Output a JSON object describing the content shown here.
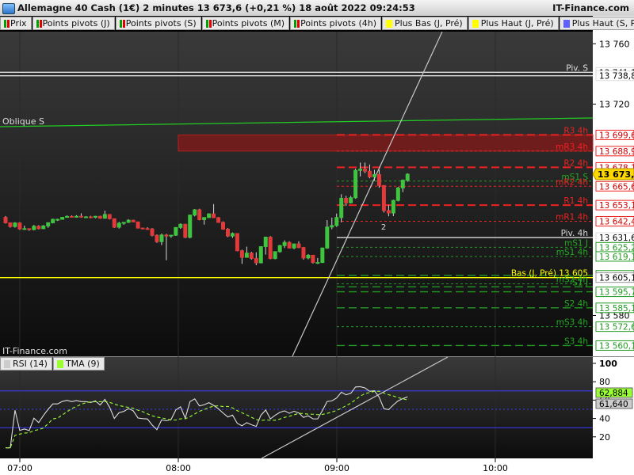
{
  "header": {
    "title": "Allemagne 40 Cash (1€) 2 minutes 13 673,6 (+0,21 %) 18 août 2022 09:24:53",
    "brand": "IT-Finance.com"
  },
  "legend": [
    {
      "label": "Prix",
      "colors": [
        "#00a000",
        "#e00000"
      ]
    },
    {
      "label": "Points pivots (J)",
      "colors": [
        "#00a000",
        "#e00000"
      ]
    },
    {
      "label": "Points pivots (S)",
      "colors": [
        "#00a000",
        "#e00000"
      ]
    },
    {
      "label": "Points pivots (M)",
      "colors": [
        "#00a000",
        "#e00000"
      ]
    },
    {
      "label": "Points pivots (4h)",
      "colors": [
        "#00a000",
        "#e00000"
      ]
    },
    {
      "label": "Plus Bas (J, Pré)",
      "colors": [
        "#ffff00"
      ]
    },
    {
      "label": "Plus Haut (J, Pré)",
      "colors": [
        "#ffff00"
      ]
    },
    {
      "label": "Plus Haut (S, Pré)",
      "colors": [
        "#6060ff"
      ]
    }
  ],
  "watermark": "IT-Finance.com",
  "rsi_legend": [
    {
      "label": "RSI (14)",
      "colors": [
        "#cccccc"
      ]
    },
    {
      "label": "TMA (9)",
      "colors": [
        "#99ff33"
      ]
    }
  ],
  "chart_data": {
    "type": "candlestick",
    "price_axis": {
      "range": [
        13553,
        13768
      ],
      "ticks": [
        "13 760",
        "13 720",
        "13 580"
      ]
    },
    "time_axis": {
      "ticks": [
        "07:00",
        "08:00",
        "09:00",
        "10:00"
      ]
    },
    "levels": [
      {
        "label": "Piv. S",
        "price_label": "13 741,1",
        "value": 13741.1,
        "color": "#dddddd",
        "style": "solid"
      },
      {
        "label": "",
        "price_label": "13 738,8",
        "value": 13738.8,
        "color": "#dddddd",
        "style": "solid"
      },
      {
        "label": "R3 4h",
        "price_label": "13 699,6",
        "value": 13699.6,
        "color": "#ee2222",
        "style": "dash"
      },
      {
        "label": "mR3 4h",
        "price_label": "13 688,9",
        "value": 13688.9,
        "color": "#ee2222",
        "style": "dot"
      },
      {
        "label": "R2 4h",
        "price_label": "13 678,1",
        "value": 13678.1,
        "color": "#ee2222",
        "style": "dash"
      },
      {
        "label": "mS1 S",
        "price_label": "",
        "value": 13669.0,
        "color": "#229922",
        "style": "dot"
      },
      {
        "label": "mR2 4h",
        "price_label": "13 665,6",
        "value": 13665.6,
        "color": "#ee2222",
        "style": "dot"
      },
      {
        "label": "R1 4h",
        "price_label": "13 653,1",
        "value": 13653.1,
        "color": "#ee2222",
        "style": "dash"
      },
      {
        "label": "mR1 4h",
        "price_label": "13 642,4",
        "value": 13642.4,
        "color": "#ee2222",
        "style": "dot"
      },
      {
        "label": "Piv. 4h",
        "price_label": "13 631,6",
        "value": 13631.6,
        "color": "#dddddd",
        "style": "solid"
      },
      {
        "label": "mS1 J",
        "price_label": "13 625,2",
        "value": 13625.2,
        "color": "#229922",
        "style": "dot"
      },
      {
        "label": "mS1 4h",
        "price_label": "13 619,1",
        "value": 13619.1,
        "color": "#229922",
        "style": "dot"
      },
      {
        "label": "",
        "price_label": "13 606,6",
        "value": 13606.6,
        "color": "#229922",
        "style": "dash"
      },
      {
        "label": "Bas (J, Pré) 13 605",
        "price_label": "13 605,1",
        "value": 13605.1,
        "color": "#ffff00",
        "style": "solid"
      },
      {
        "label": "mS2 4h",
        "price_label": "",
        "value": 13601.0,
        "color": "#229922",
        "style": "dot"
      },
      {
        "label": "S1 J",
        "price_label": "",
        "value": 13599.0,
        "color": "#229922",
        "style": "dash"
      },
      {
        "label": "",
        "price_label": "13 595,7",
        "value": 13595.7,
        "color": "#229922",
        "style": "dash"
      },
      {
        "label": "S2 4h",
        "price_label": "13 585,1",
        "value": 13585.1,
        "color": "#229922",
        "style": "dash"
      },
      {
        "label": "mS3 4h",
        "price_label": "13 572,6",
        "value": 13572.6,
        "color": "#229922",
        "style": "dot"
      },
      {
        "label": "S3 4h",
        "price_label": "13 560,1",
        "value": 13560.1,
        "color": "#229922",
        "style": "dash"
      }
    ],
    "last_price": {
      "value": 13673.6,
      "label": "13 673,6"
    },
    "zone": {
      "from": 13688.9,
      "to": 13699.6,
      "color": "#7a1a1a"
    },
    "oblique": {
      "label": "Oblique S",
      "color": "#22cc22"
    },
    "annotation": "2",
    "candles": [
      [
        13645.0,
        13645.9,
        13640.9,
        13641.4
      ],
      [
        13641.4,
        13641.5,
        13638.2,
        13638.9
      ],
      [
        13638.9,
        13641.8,
        13638.2,
        13641.3
      ],
      [
        13641.3,
        13641.8,
        13636.7,
        13637.3
      ],
      [
        13637.3,
        13639.5,
        13636.9,
        13637.5
      ],
      [
        13637.5,
        13637.5,
        13636.1,
        13636.9
      ],
      [
        13636.9,
        13640.0,
        13636.4,
        13639.1
      ],
      [
        13639.1,
        13639.8,
        13637.0,
        13637.5
      ],
      [
        13637.5,
        13639.9,
        13637.2,
        13639.3
      ],
      [
        13639.3,
        13641.8,
        13638.1,
        13641.4
      ],
      [
        13641.4,
        13644.1,
        13641.0,
        13643.7
      ],
      [
        13643.7,
        13644.1,
        13642.6,
        13643.7
      ],
      [
        13643.7,
        13645.3,
        13643.5,
        13645.0
      ],
      [
        13645.0,
        13646.3,
        13644.8,
        13645.6
      ],
      [
        13645.6,
        13646.3,
        13645.0,
        13645.1
      ],
      [
        13645.1,
        13646.4,
        13644.8,
        13645.7
      ],
      [
        13645.7,
        13647.7,
        13644.7,
        13645.3
      ],
      [
        13645.3,
        13645.8,
        13645.1,
        13645.3
      ],
      [
        13645.3,
        13646.0,
        13644.4,
        13645.0
      ],
      [
        13645.0,
        13646.0,
        13644.4,
        13645.7
      ],
      [
        13645.7,
        13646.1,
        13644.1,
        13644.4
      ],
      [
        13644.4,
        13649.4,
        13644.2,
        13646.9
      ],
      [
        13646.9,
        13647.1,
        13643.6,
        13644.1
      ],
      [
        13644.1,
        13644.2,
        13638.0,
        13638.5
      ],
      [
        13638.5,
        13642.0,
        13637.6,
        13641.1
      ],
      [
        13641.1,
        13641.8,
        13640.1,
        13641.7
      ],
      [
        13641.7,
        13643.8,
        13641.3,
        13643.1
      ],
      [
        13643.1,
        13643.3,
        13641.9,
        13642.0
      ],
      [
        13642.0,
        13642.0,
        13637.6,
        13637.9
      ],
      [
        13637.9,
        13638.2,
        13637.0,
        13637.5
      ],
      [
        13637.5,
        13638.5,
        13636.9,
        13637.3
      ],
      [
        13637.3,
        13637.9,
        13632.4,
        13633.1
      ],
      [
        13633.1,
        13633.7,
        13628.1,
        13628.9
      ],
      [
        13628.9,
        13634.3,
        13626.6,
        13633.3
      ],
      [
        13633.3,
        13634.1,
        13616.6,
        13632.6
      ],
      [
        13632.6,
        13633.3,
        13631.5,
        13633.2
      ],
      [
        13633.2,
        13638.3,
        13632.7,
        13638.3
      ],
      [
        13638.3,
        13641.0,
        13637.4,
        13640.4
      ],
      [
        13640.4,
        13640.7,
        13631.2,
        13631.8
      ],
      [
        13631.8,
        13646.8,
        13631.1,
        13646.5
      ],
      [
        13646.5,
        13650.5,
        13645.7,
        13650.0
      ],
      [
        13650.0,
        13650.7,
        13643.0,
        13643.5
      ],
      [
        13643.5,
        13645.0,
        13640.2,
        13644.9
      ],
      [
        13644.9,
        13647.6,
        13644.6,
        13647.3
      ],
      [
        13647.3,
        13653.8,
        13644.6,
        13644.8
      ],
      [
        13644.8,
        13645.2,
        13641.4,
        13641.7
      ],
      [
        13641.7,
        13642.3,
        13636.8,
        13637.2
      ],
      [
        13637.2,
        13637.9,
        13631.9,
        13632.6
      ],
      [
        13632.6,
        13635.0,
        13631.4,
        13634.3
      ],
      [
        13634.3,
        13634.4,
        13622.5,
        13622.9
      ],
      [
        13622.9,
        13623.6,
        13614.2,
        13618.5
      ],
      [
        13618.5,
        13625.6,
        13618.4,
        13621.3
      ],
      [
        13621.3,
        13622.2,
        13617.0,
        13617.8
      ],
      [
        13617.8,
        13621.9,
        13613.3,
        13614.9
      ],
      [
        13614.9,
        13625.9,
        13614.5,
        13625.6
      ],
      [
        13625.6,
        13632.2,
        13620.3,
        13631.9
      ],
      [
        13631.9,
        13632.6,
        13617.2,
        13617.7
      ],
      [
        13617.7,
        13622.4,
        13617.2,
        13622.3
      ],
      [
        13622.3,
        13626.8,
        13621.6,
        13626.3
      ],
      [
        13626.3,
        13629.8,
        13624.7,
        13628.4
      ],
      [
        13628.4,
        13629.2,
        13624.4,
        13624.7
      ],
      [
        13624.7,
        13627.5,
        13623.9,
        13627.4
      ],
      [
        13627.4,
        13629.2,
        13624.6,
        13625.0
      ],
      [
        13625.0,
        13625.4,
        13617.0,
        13618.1
      ],
      [
        13618.1,
        13620.7,
        13617.2,
        13619.9
      ],
      [
        13619.9,
        13620.0,
        13614.4,
        13615.1
      ],
      [
        13615.1,
        13618.1,
        13614.1,
        13615.1
      ],
      [
        13615.1,
        13625.0,
        13614.8,
        13624.7
      ],
      [
        13624.7,
        13643.2,
        13624.1,
        13638.6
      ],
      [
        13638.6,
        13644.8,
        13637.1,
        13639.6
      ],
      [
        13639.6,
        13647.5,
        13638.7,
        13644.9
      ],
      [
        13644.9,
        13660.3,
        13641.7,
        13657.6
      ],
      [
        13657.6,
        13659.2,
        13652.6,
        13654.6
      ],
      [
        13654.6,
        13659.2,
        13654.2,
        13658.0
      ],
      [
        13658.0,
        13677.2,
        13657.3,
        13676.1
      ],
      [
        13676.1,
        13681.3,
        13672.1,
        13676.9
      ],
      [
        13676.9,
        13681.3,
        13674.3,
        13675.6
      ],
      [
        13675.6,
        13680.0,
        13670.9,
        13671.8
      ],
      [
        13671.8,
        13676.5,
        13669.2,
        13673.4
      ],
      [
        13673.4,
        13676.5,
        13664.6,
        13666.1
      ],
      [
        13666.1,
        13666.3,
        13648.2,
        13649.5
      ],
      [
        13649.5,
        13653.3,
        13645.7,
        13647.9
      ],
      [
        13647.9,
        13656.7,
        13645.8,
        13656.2
      ],
      [
        13656.2,
        13665.2,
        13655.6,
        13664.5
      ],
      [
        13664.5,
        13670.1,
        13661.7,
        13669.6
      ],
      [
        13669.6,
        13674.2,
        13668.6,
        13673.6
      ]
    ],
    "rsi": {
      "ticks": [
        "100",
        "80",
        "60",
        "40",
        "20"
      ],
      "levels": [
        70,
        30
      ],
      "mid": 50,
      "value_label": "61,640",
      "tma_label": "62,884"
    }
  }
}
